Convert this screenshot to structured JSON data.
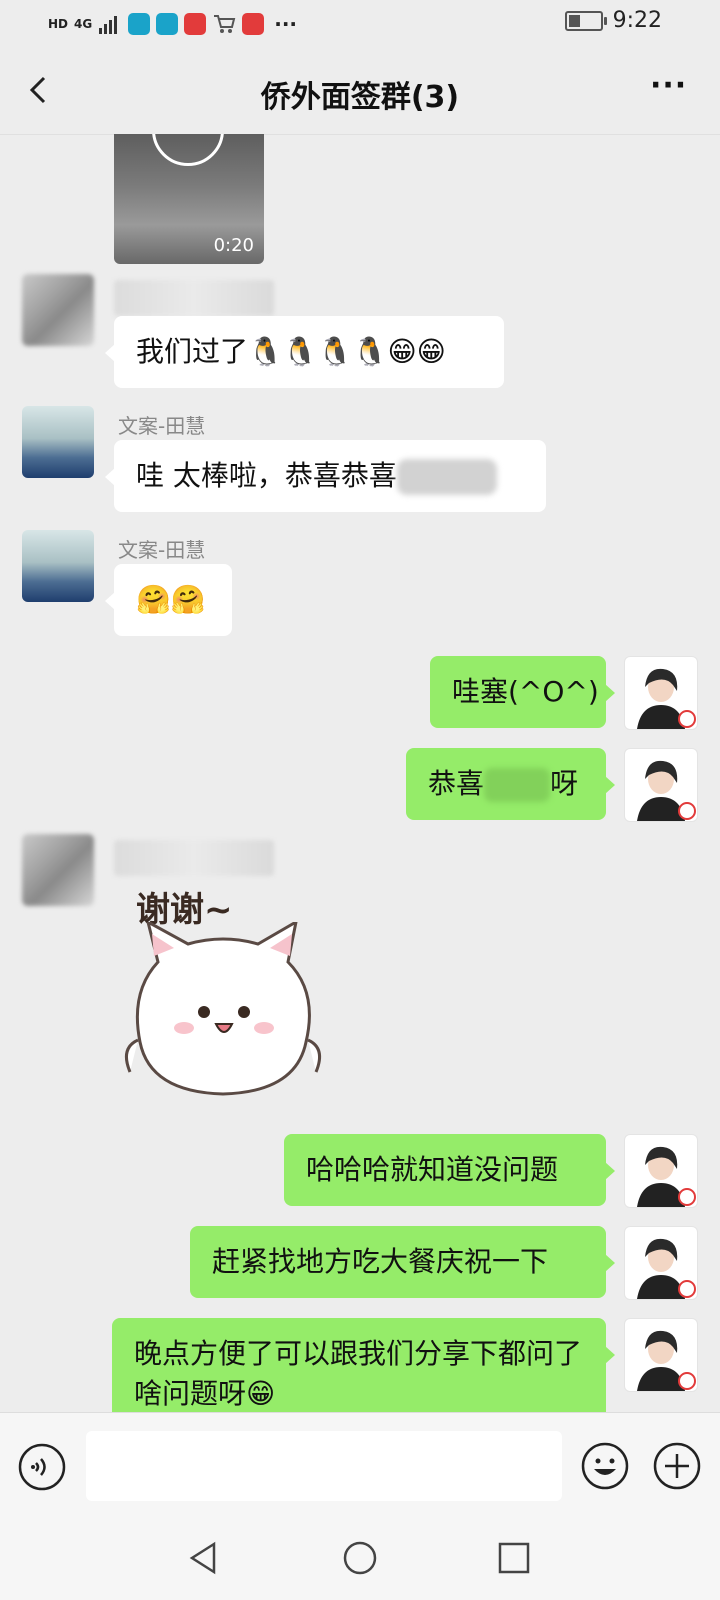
{
  "status_bar": {
    "network_labels": [
      "HD",
      "4G"
    ],
    "time": "9:22",
    "battery_level": 0.35,
    "overflow": "···",
    "app_icons": [
      {
        "name": "check-app-icon",
        "color": "#1aa3c9"
      },
      {
        "name": "check-app-icon",
        "color": "#1aa3c9"
      },
      {
        "name": "mic-app-icon",
        "color": "#e23b3b"
      },
      {
        "name": "cart-app-icon",
        "color": "#555555"
      },
      {
        "name": "book-app-icon",
        "color": "#e23b3b"
      }
    ]
  },
  "header": {
    "title": "侨外面签群(3)",
    "back_icon": "chevron-left-icon",
    "more_label": "···"
  },
  "video": {
    "duration": "0:20"
  },
  "messages": [
    {
      "side": "in",
      "sender": "",
      "text": "我们过了🐧🐧🐧🐧😁😁"
    },
    {
      "side": "in",
      "sender": "文案-田慧",
      "text": "哇  太棒啦，恭喜恭喜"
    },
    {
      "side": "in",
      "sender": "文案-田慧",
      "text": "🤗🤗"
    },
    {
      "side": "out",
      "text": "哇塞(^O^)"
    },
    {
      "side": "out",
      "text_before": "恭喜",
      "text_after": "呀"
    },
    {
      "side": "in",
      "sender": "",
      "sticker_caption": "谢谢~"
    },
    {
      "side": "out",
      "text": "哈哈哈就知道没问题"
    },
    {
      "side": "out",
      "text": "赶紧找地方吃大餐庆祝一下"
    },
    {
      "side": "out",
      "text": "晚点方便了可以跟我们分享下都问了啥问题呀😁"
    }
  ],
  "input_bar": {
    "value": "",
    "placeholder": "",
    "voice_icon": "voice-icon",
    "emoji_icon": "emoji-icon",
    "plus_icon": "plus-icon"
  },
  "system_nav": {
    "icons": [
      "back-triangle-icon",
      "home-circle-icon",
      "recent-square-icon"
    ]
  }
}
